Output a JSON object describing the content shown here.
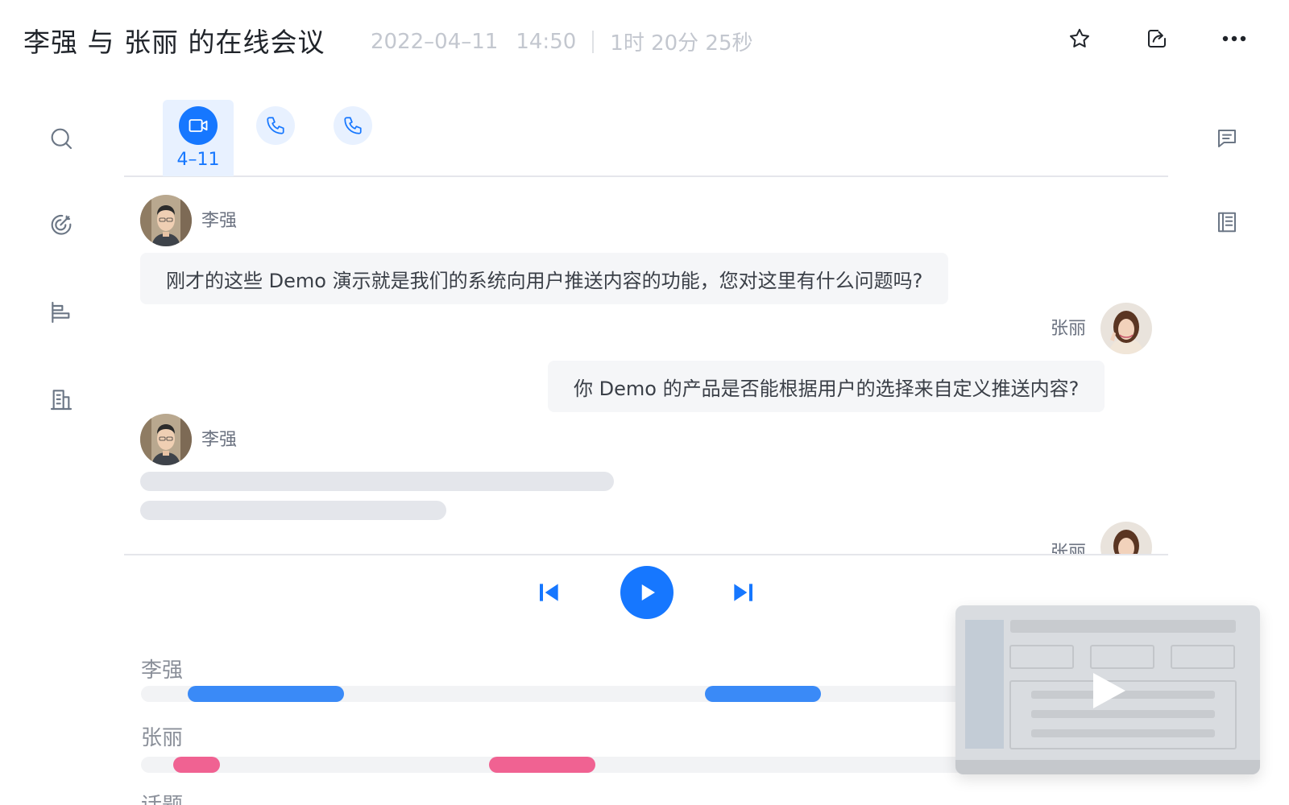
{
  "header": {
    "title": "李强 与  张丽 的在线会议",
    "date": "2022–04–11",
    "time": "14:50",
    "duration": "1时 20分 25秒",
    "icons": [
      "star-icon",
      "share-icon",
      "more-icon"
    ]
  },
  "sidebar": {
    "icons": [
      "search-icon",
      "target-icon",
      "align-left-icon",
      "building-icon"
    ]
  },
  "right_rail": {
    "icons": [
      "comment-icon",
      "notes-icon"
    ]
  },
  "recordings": {
    "tabs": [
      {
        "type": "video",
        "label": "4–11",
        "active": true
      },
      {
        "type": "phone",
        "label": "",
        "active": false
      },
      {
        "type": "phone",
        "label": "",
        "active": false
      }
    ]
  },
  "transcript": {
    "entries": [
      {
        "speaker": "李强",
        "side": "left",
        "text": "刚才的这些 Demo 演示就是我们的系统向用户推送内容的功能，您对这里有什么问题吗?"
      },
      {
        "speaker": "张丽",
        "side": "right",
        "text": "你 Demo 的产品是否能根据用户的选择来自定义推送内容?"
      },
      {
        "speaker": "李强",
        "side": "left",
        "text": ""
      },
      {
        "speaker": "张丽",
        "side": "right",
        "text": ""
      }
    ]
  },
  "timeline": {
    "tracks": [
      {
        "label": "李强",
        "color": "#3a8af7"
      },
      {
        "label": "张丽",
        "color": "#f06292"
      },
      {
        "label": "话题",
        "color": ""
      }
    ]
  },
  "colors": {
    "accent": "#1677ff",
    "speaker_a": "#3a8af7",
    "speaker_b": "#f06292"
  }
}
